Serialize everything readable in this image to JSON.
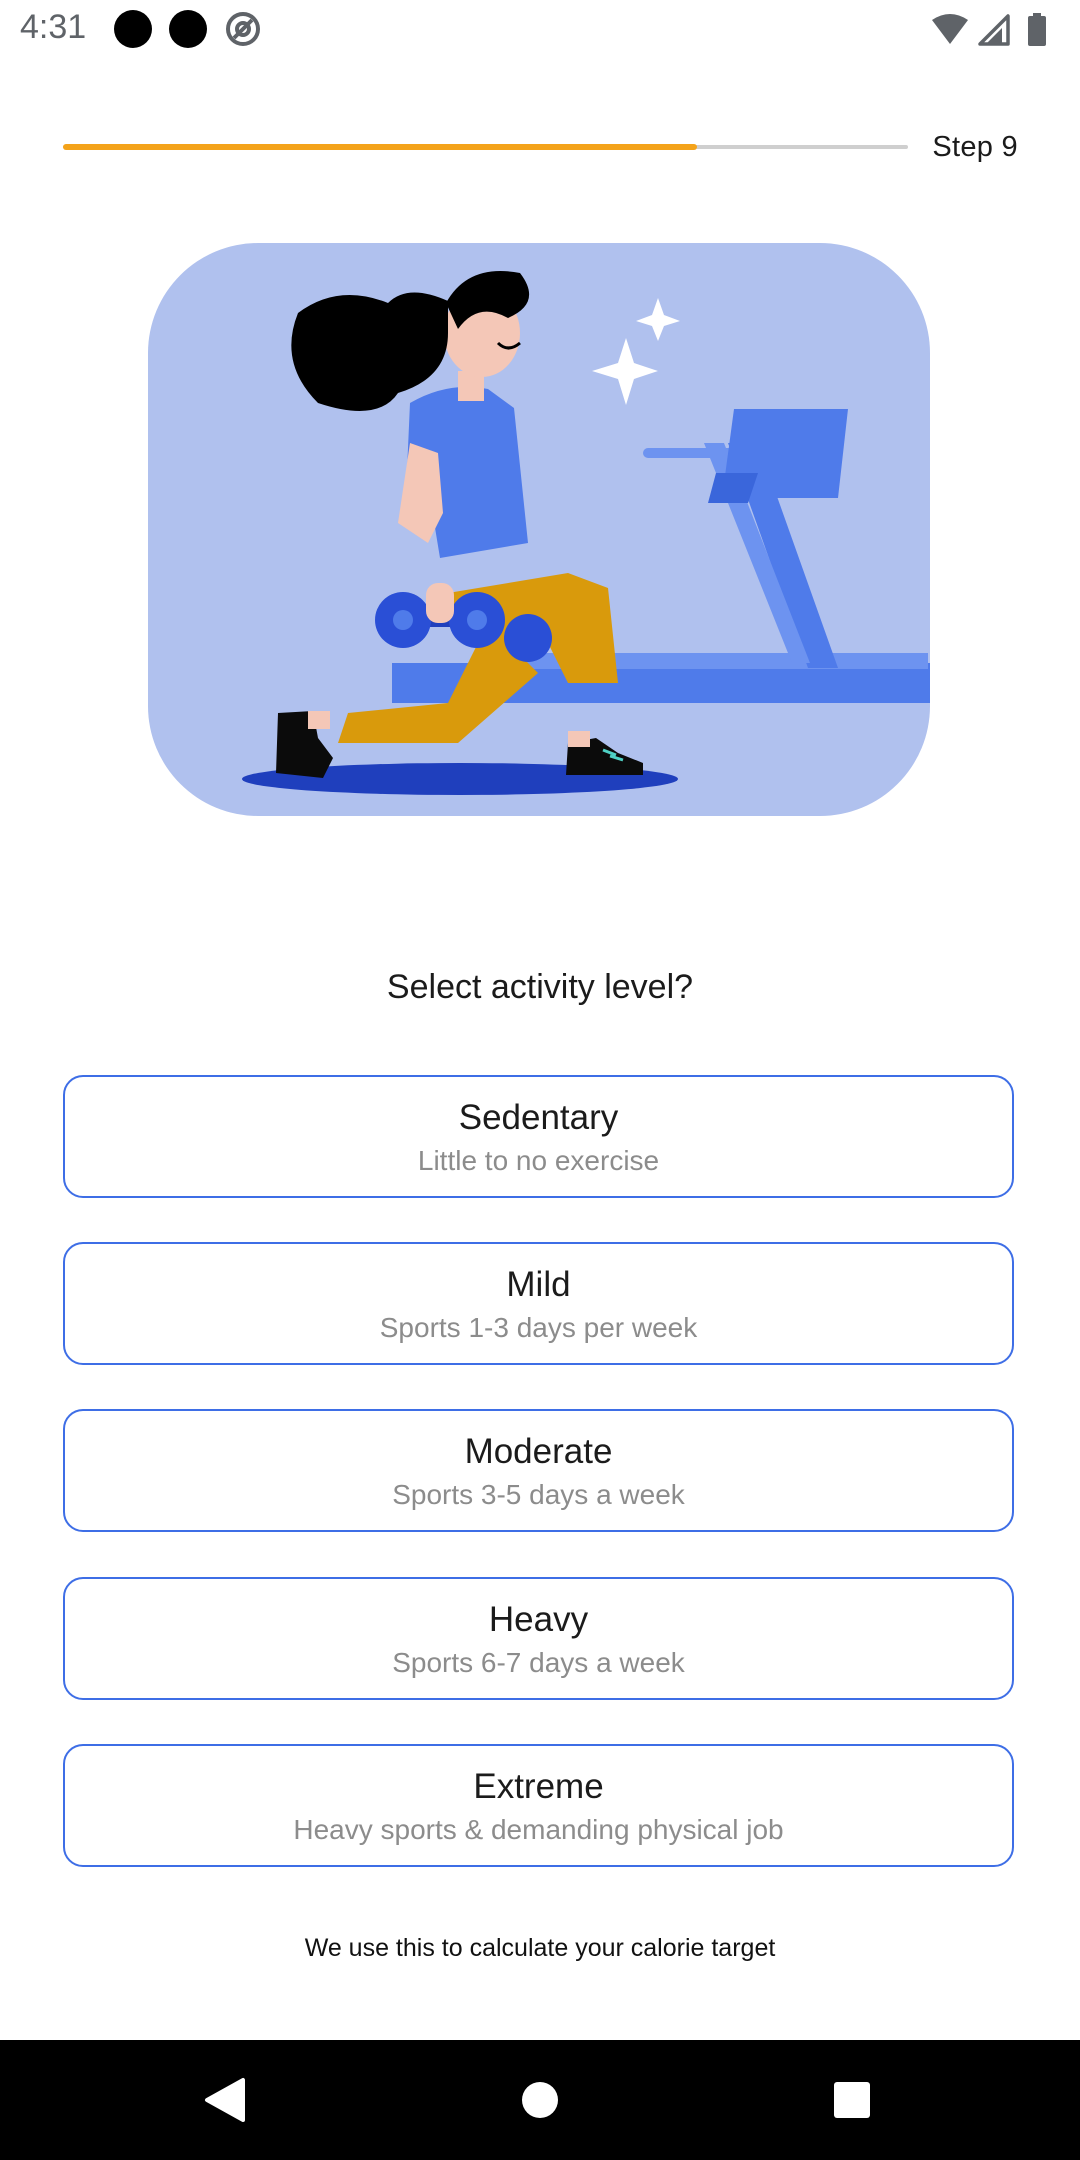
{
  "status_bar": {
    "time": "4:31",
    "icons": [
      "notification-dot-icon",
      "notification-dot-icon",
      "at-sign-icon",
      "wifi-icon",
      "cell-signal-icon",
      "battery-icon"
    ]
  },
  "progress": {
    "step_label": "Step 9",
    "fraction": 0.75,
    "fill_color": "#f4a31a",
    "track_color": "#cfcfcf"
  },
  "illustration": {
    "background_color": "#b0c1ee",
    "icon": "woman-lunging-with-dumbbells-illustration"
  },
  "question": "Select activity level?",
  "options": [
    {
      "title": "Sedentary",
      "subtitle": "Little to no exercise"
    },
    {
      "title": "Mild",
      "subtitle": "Sports 1-3 days per week"
    },
    {
      "title": "Moderate",
      "subtitle": "Sports 3-5 days a week"
    },
    {
      "title": "Heavy",
      "subtitle": "Sports 6-7 days a week"
    },
    {
      "title": "Extreme",
      "subtitle": "Heavy sports & demanding physical job"
    }
  ],
  "footnote": "We use this to calculate your calorie target",
  "accent_color": "#3e6ee6",
  "nav_bar": {
    "icons": [
      "back-icon",
      "home-icon",
      "recents-icon"
    ]
  }
}
